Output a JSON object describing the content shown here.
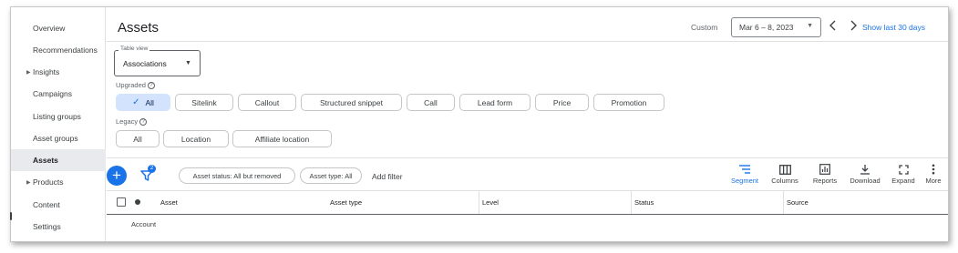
{
  "sidebar": {
    "items": [
      {
        "label": "Overview",
        "active": false,
        "expandable": false
      },
      {
        "label": "Recommendations",
        "active": false,
        "expandable": false
      },
      {
        "label": "Insights",
        "active": false,
        "expandable": true
      },
      {
        "label": "Campaigns",
        "active": false,
        "expandable": false
      },
      {
        "label": "Listing groups",
        "active": false,
        "expandable": false
      },
      {
        "label": "Asset groups",
        "active": false,
        "expandable": false
      },
      {
        "label": "Assets",
        "active": true,
        "expandable": false
      },
      {
        "label": "Products",
        "active": false,
        "expandable": true
      },
      {
        "label": "Content",
        "active": false,
        "expandable": false
      },
      {
        "label": "Settings",
        "active": false,
        "expandable": false
      }
    ]
  },
  "header": {
    "title": "Assets",
    "custom_label": "Custom",
    "date_range": "Mar 6 – 8, 2023",
    "show_last_label": "Show last 30 days"
  },
  "table_view": {
    "legend": "Table view",
    "value": "Associations"
  },
  "upgraded": {
    "label": "Upgraded",
    "chips": [
      "All",
      "Sitelink",
      "Callout",
      "Structured snippet",
      "Call",
      "Lead form",
      "Price",
      "Promotion"
    ],
    "selected": "All"
  },
  "legacy": {
    "label": "Legacy",
    "chips": [
      "All",
      "Location",
      "Affiliate location"
    ]
  },
  "toolbar": {
    "filter_badge": "2",
    "filter_pills": [
      "Asset status: All but removed",
      "Asset type: All"
    ],
    "add_filter_label": "Add filter",
    "tools": [
      {
        "label": "Segment",
        "icon": "segment-icon",
        "active": true
      },
      {
        "label": "Columns",
        "icon": "columns-icon",
        "active": false
      },
      {
        "label": "Reports",
        "icon": "reports-icon",
        "active": false
      },
      {
        "label": "Download",
        "icon": "download-icon",
        "active": false
      },
      {
        "label": "Expand",
        "icon": "expand-icon",
        "active": false
      },
      {
        "label": "More",
        "icon": "more-vert-icon",
        "active": false
      }
    ]
  },
  "table": {
    "columns": [
      "Asset",
      "Asset type",
      "Level",
      "Status",
      "Source"
    ],
    "rows": [
      [
        "Account"
      ]
    ]
  },
  "colors": {
    "accent": "#1a73e8",
    "selected_chip_bg": "#d3e3fd",
    "sidebar_active_bg": "#e8eaed"
  }
}
